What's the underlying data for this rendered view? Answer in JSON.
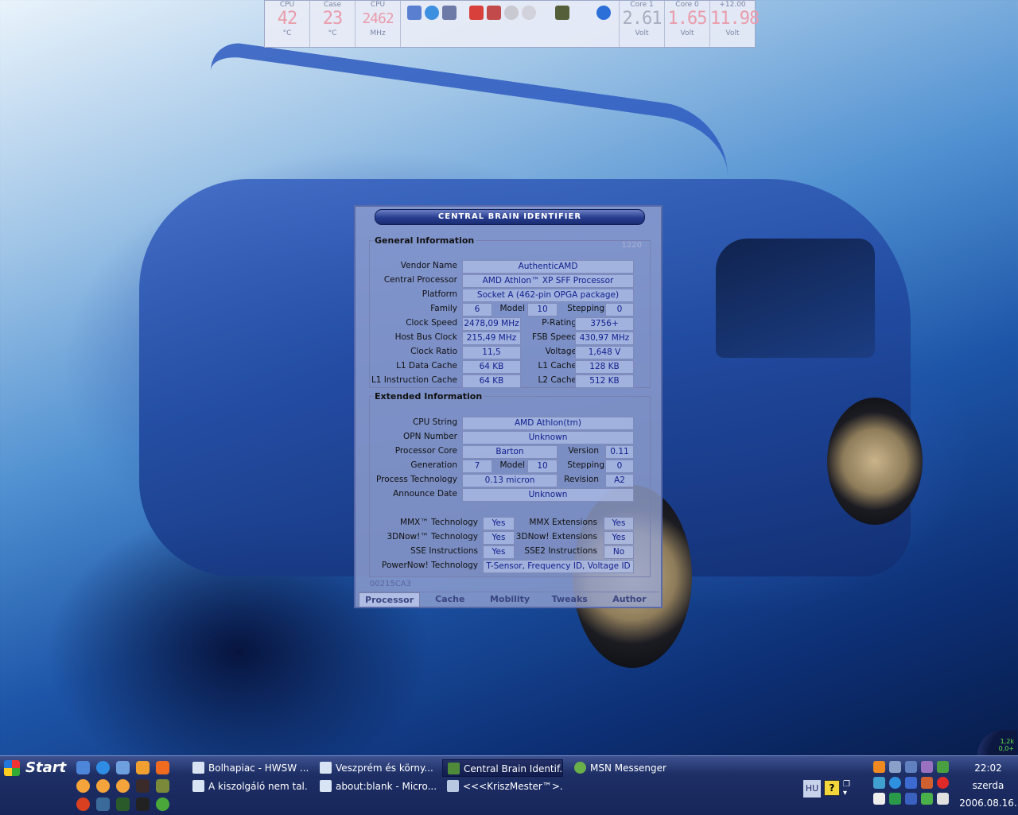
{
  "sensors": {
    "gauges_left": [
      {
        "label": "CPU",
        "value": "42",
        "unit": "°C"
      },
      {
        "label": "Case",
        "value": "23",
        "unit": "°C"
      },
      {
        "label": "CPU",
        "value": "2462",
        "unit": "MHz"
      }
    ],
    "gauges_right": [
      {
        "label": "Core 1",
        "value": "2.61",
        "unit": "Volt"
      },
      {
        "label": "Core 0",
        "value": "1.65",
        "unit": "Volt"
      },
      {
        "label": "+12.00",
        "value": "11.98",
        "unit": "Volt"
      }
    ],
    "icons": [
      "documents-icon",
      "internet-explorer-icon",
      "settings-icon",
      "checklist-icon",
      "tool-icon",
      "cd-icon",
      "disc-icon",
      "drive-icon",
      "globe-icon"
    ]
  },
  "cbid": {
    "title": "CENTRAL BRAIN IDENTIFIER",
    "general": {
      "legend": "General Information",
      "mark": "1220",
      "vendor_label": "Vendor Name",
      "vendor": "AuthenticAMD",
      "cpu_label": "Central Processor",
      "cpu": "AMD Athlon™ XP SFF  Processor",
      "platform_label": "Platform",
      "platform": "Socket A (462-pin OPGA package)",
      "family_label": "Family",
      "family": "6",
      "model_label": "Model",
      "model": "10",
      "stepping_label": "Stepping",
      "stepping": "0",
      "clock_label": "Clock Speed",
      "clock": "2478,09 MHz",
      "prating_label": "P-Rating",
      "prating": "3756+",
      "hostbus_label": "Host Bus Clock",
      "hostbus": "215,49 MHz",
      "fsb_label": "FSB Speed",
      "fsb": "430,97 MHz",
      "ratio_label": "Clock Ratio",
      "ratio": "11,5",
      "voltage_label": "Voltage",
      "voltage": "1,648 V",
      "l1d_label": "L1 Data Cache",
      "l1d": "64 KB",
      "l1_label": "L1 Cache",
      "l1": "128 KB",
      "l1i_label": "L1 Instruction Cache",
      "l1i": "64 KB",
      "l2_label": "L2 Cache",
      "l2": "512 KB"
    },
    "extended": {
      "legend": "Extended Information",
      "cpustring_label": "CPU String",
      "cpustring": "AMD Athlon(tm)",
      "opn_label": "OPN Number",
      "opn": "Unknown",
      "core_label": "Processor Core",
      "core": "Barton",
      "version_label": "Version",
      "version": "0.11",
      "gen_label": "Generation",
      "gen": "7",
      "model_label": "Model",
      "model": "10",
      "stepping_label": "Stepping",
      "stepping": "0",
      "tech_label": "Process Technology",
      "tech": "0.13 micron",
      "revision_label": "Revision",
      "revision": "A2",
      "announce_label": "Announce Date",
      "announce": "Unknown",
      "mmx_label": "MMX™ Technology",
      "mmx": "Yes",
      "mmxext_label": "MMX Extensions",
      "mmxext": "Yes",
      "now_label": "3DNow!™ Technology",
      "now": "Yes",
      "nowext_label": "3DNow! Extensions",
      "nowext": "Yes",
      "sse_label": "SSE Instructions",
      "sse": "Yes",
      "sse2_label": "SSE2 Instructions",
      "sse2": "No",
      "powernow_label": "PowerNow! Technology",
      "powernow": "T-Sensor, Frequency ID, Voltage ID"
    },
    "serial": "00215CA3",
    "tabs": [
      "Processor",
      "Cache",
      "Mobility",
      "Tweaks",
      "Author"
    ]
  },
  "taskbar": {
    "start_label": "Start",
    "tasks": [
      {
        "label": "Bolhapiac - HWSW ..."
      },
      {
        "label": "Veszprém és körny..."
      },
      {
        "label": "Central Brain Identif..."
      },
      {
        "label": "MSN Messenger"
      },
      {
        "label": "A kiszolgáló nem tal..."
      },
      {
        "label": "about:blank - Micro..."
      },
      {
        "label": "<<<KriszMester™>..."
      }
    ],
    "lang": "HU",
    "help": "?",
    "clock": {
      "time": "22:02",
      "day": "szerda",
      "date": "2006.08.16."
    },
    "netmeter": {
      "down": "1,2k",
      "up": "0,0+"
    }
  },
  "colors": {
    "accent": "#263c8e",
    "value_text": "#13208e",
    "gauge_digits": "#e99cab"
  }
}
